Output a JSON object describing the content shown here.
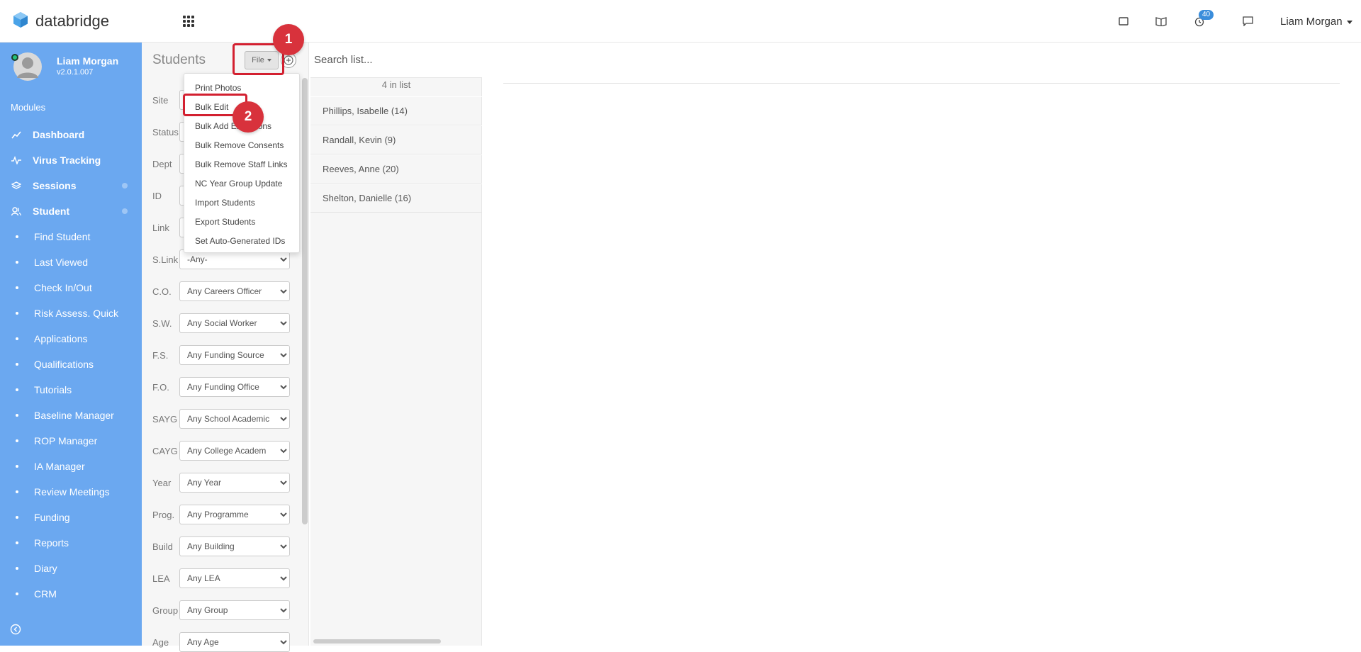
{
  "app": {
    "brand": "databridge"
  },
  "topbar": {
    "notification_count": "40",
    "user_name": "Liam Morgan"
  },
  "sidebar": {
    "user_name": "Liam Morgan",
    "version": "v2.0.1.007",
    "modules_label": "Modules",
    "main_items": [
      {
        "label": "Dashboard",
        "icon": "chart-line-icon"
      },
      {
        "label": "Virus Tracking",
        "icon": "pulse-icon"
      },
      {
        "label": "Sessions",
        "icon": "layers-icon"
      },
      {
        "label": "Student",
        "icon": "users-icon"
      }
    ],
    "sub_items": [
      "Find Student",
      "Last Viewed",
      "Check In/Out",
      "Risk Assess. Quick",
      "Applications",
      "Qualifications",
      "Tutorials",
      "Baseline Manager",
      "ROP Manager",
      "IA Manager",
      "Review Meetings",
      "Funding",
      "Reports",
      "Diary",
      "CRM"
    ]
  },
  "filter_panel": {
    "title": "Students",
    "file_button": "File",
    "filters": [
      {
        "label": "Site",
        "value": ""
      },
      {
        "label": "Status",
        "value": ""
      },
      {
        "label": "Dept",
        "value": ""
      },
      {
        "label": "ID",
        "value": ""
      },
      {
        "label": "Link",
        "value": ""
      },
      {
        "label": "S.Link",
        "value": "-Any-"
      },
      {
        "label": "C.O.",
        "value": "Any Careers Officer"
      },
      {
        "label": "S.W.",
        "value": "Any Social Worker"
      },
      {
        "label": "F.S.",
        "value": "Any Funding Source"
      },
      {
        "label": "F.O.",
        "value": "Any Funding Office"
      },
      {
        "label": "SAYG",
        "value": "Any School Academic"
      },
      {
        "label": "CAYG",
        "value": "Any College Academ"
      },
      {
        "label": "Year",
        "value": "Any Year"
      },
      {
        "label": "Prog.",
        "value": "Any Programme"
      },
      {
        "label": "Build",
        "value": "Any Building"
      },
      {
        "label": "LEA",
        "value": "Any LEA"
      },
      {
        "label": "Group",
        "value": "Any Group"
      },
      {
        "label": "Age",
        "value": "Any Age"
      }
    ]
  },
  "file_menu": {
    "items": [
      "Print Photos",
      "Bulk Edit",
      "Bulk Add Exclusions",
      "Bulk Remove Consents",
      "Bulk Remove Staff Links",
      "NC Year Group Update",
      "Import Students",
      "Export Students",
      "Set Auto-Generated IDs"
    ]
  },
  "list": {
    "search_placeholder": "Search list...",
    "count_text": "4 in list",
    "rows": [
      "Phillips, Isabelle (14)",
      "Randall, Kevin (9)",
      "Reeves, Anne (20)",
      "Shelton, Danielle (16)"
    ]
  },
  "annotations": {
    "step1": "1",
    "step2": "2"
  },
  "colors": {
    "sidebar": "#6ba8f0",
    "highlight": "#d32030",
    "marker": "#d8323c",
    "badge": "#3a8ddb"
  }
}
